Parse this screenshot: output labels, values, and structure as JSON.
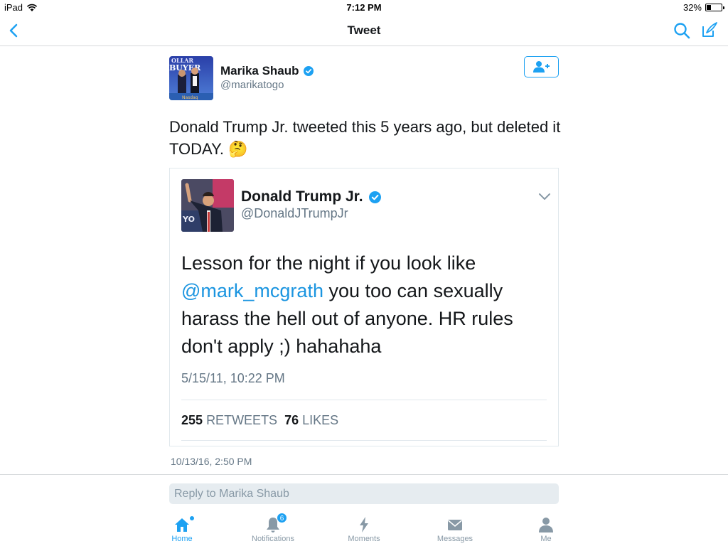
{
  "status_bar": {
    "device": "iPad",
    "time": "7:12 PM",
    "battery_text": "32%",
    "battery_level": 0.32
  },
  "nav": {
    "title": "Tweet"
  },
  "tweet": {
    "author_name": "Marika Shaub",
    "author_handle": "@marikatogo",
    "avatar_text_top": "OLLAR",
    "avatar_text_mid": "BUYER",
    "avatar_text_bottom": "Nasdaq",
    "text": "Donald Trump Jr. tweeted this 5 years ago, but deleted it TODAY. 🤔",
    "timestamp": "10/13/16, 2:50 PM"
  },
  "quoted": {
    "author_name": "Donald Trump Jr.",
    "author_handle": "@DonaldJTrumpJr",
    "avatar_text": "YO",
    "text_before": "Lesson for the night if you look like ",
    "mention": "@mark_mcgrath",
    "text_after": " you too can sexually harass the hell out of anyone. HR rules don't apply  ;) hahahaha",
    "timestamp": "5/15/11, 10:22 PM",
    "retweets_count": "255",
    "retweets_label": "RETWEETS",
    "likes_count": "76",
    "likes_label": "LIKES"
  },
  "reply": {
    "placeholder": "Reply to Marika Shaub"
  },
  "tabs": [
    {
      "label": "Home",
      "icon": "home-icon",
      "active": true
    },
    {
      "label": "Notifications",
      "icon": "bell-icon",
      "badge": "6"
    },
    {
      "label": "Moments",
      "icon": "lightning-icon"
    },
    {
      "label": "Messages",
      "icon": "envelope-icon"
    },
    {
      "label": "Me",
      "icon": "person-icon"
    }
  ],
  "colors": {
    "accent": "#1da1f2",
    "secondary_text": "#657786",
    "tab_inactive": "#8899a6"
  }
}
